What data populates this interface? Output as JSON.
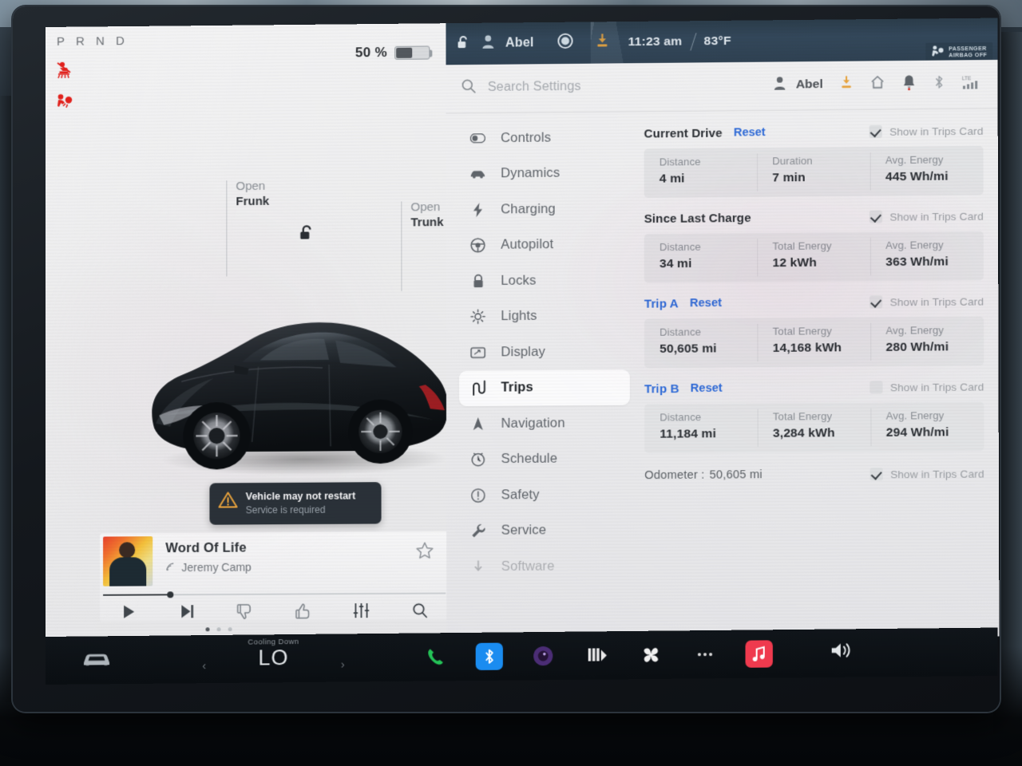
{
  "drive_panel": {
    "gear_indicator": "P R N D",
    "battery_percent": "50 %",
    "battery_level": 50,
    "warning_icons": [
      "seatbelt-warning-icon",
      "airbag-warning-icon"
    ],
    "frunk": {
      "action": "Open",
      "target": "Frunk"
    },
    "trunk": {
      "action": "Open",
      "target": "Trunk"
    },
    "lock_icon": "unlocked-padlock-icon",
    "charge_icon": "charge-bolt-icon",
    "toast": {
      "title": "Vehicle may not restart",
      "subtitle": "Service is required",
      "icon": "warning-triangle-icon"
    },
    "media": {
      "title": "Word Of Life",
      "artist": "Jeremy Camp",
      "source_icon": "streaming-icon",
      "favorite_icon": "star-outline-icon",
      "controls": [
        "play-icon",
        "next-track-icon",
        "thumbs-down-icon",
        "thumbs-up-icon",
        "equalizer-icon",
        "search-icon"
      ],
      "progress_percent": 19,
      "page_dots": 3,
      "active_dot": 1
    }
  },
  "status_bar": {
    "lock_icon": "unlocked-padlock-icon",
    "profile_icon": "person-icon",
    "driver_name": "Abel",
    "record_icon": "dashcam-record-icon",
    "download_icon": "software-download-icon",
    "time": "11:23 am",
    "temperature": "83°F",
    "airbag_notice_line1": "PASSENGER",
    "airbag_notice_line2": "AIRBAG OFF"
  },
  "search": {
    "placeholder": "Search Settings",
    "icon": "search-icon"
  },
  "header_icons": {
    "profile_name": "Abel",
    "items": [
      "person-icon",
      "software-download-icon",
      "home-icon",
      "notification-bell-icon",
      "bluetooth-icon",
      "lte-signal-icon"
    ],
    "lte_label": "LTE"
  },
  "sidebar": {
    "items": [
      {
        "label": "Controls",
        "icon": "toggle-switch-icon",
        "active": false,
        "dim": false
      },
      {
        "label": "Dynamics",
        "icon": "car-side-icon",
        "active": false,
        "dim": false
      },
      {
        "label": "Charging",
        "icon": "lightning-bolt-icon",
        "active": false,
        "dim": false
      },
      {
        "label": "Autopilot",
        "icon": "steering-wheel-icon",
        "active": false,
        "dim": false
      },
      {
        "label": "Locks",
        "icon": "padlock-icon",
        "active": false,
        "dim": false
      },
      {
        "label": "Lights",
        "icon": "headlight-icon",
        "active": false,
        "dim": false
      },
      {
        "label": "Display",
        "icon": "display-icon",
        "active": false,
        "dim": false
      },
      {
        "label": "Trips",
        "icon": "winding-road-icon",
        "active": true,
        "dim": false
      },
      {
        "label": "Navigation",
        "icon": "navigation-arrow-icon",
        "active": false,
        "dim": false
      },
      {
        "label": "Schedule",
        "icon": "clock-icon",
        "active": false,
        "dim": false
      },
      {
        "label": "Safety",
        "icon": "exclamation-circle-icon",
        "active": false,
        "dim": false
      },
      {
        "label": "Service",
        "icon": "wrench-icon",
        "active": false,
        "dim": false
      },
      {
        "label": "Software",
        "icon": "download-arrow-icon",
        "active": false,
        "dim": true
      }
    ]
  },
  "trips": {
    "show_label": "Show in Trips Card",
    "reset_label": "Reset",
    "sections": [
      {
        "title": "Current Drive",
        "title_is_link": false,
        "has_reset": true,
        "show_in_card": true,
        "cells": [
          {
            "key": "Distance",
            "value": "4 mi"
          },
          {
            "key": "Duration",
            "value": "7 min"
          },
          {
            "key": "Avg. Energy",
            "value": "445 Wh/mi"
          }
        ]
      },
      {
        "title": "Since Last Charge",
        "title_is_link": false,
        "has_reset": false,
        "show_in_card": true,
        "cells": [
          {
            "key": "Distance",
            "value": "34 mi"
          },
          {
            "key": "Total Energy",
            "value": "12 kWh"
          },
          {
            "key": "Avg. Energy",
            "value": "363 Wh/mi"
          }
        ]
      },
      {
        "title": "Trip A",
        "title_is_link": true,
        "has_reset": true,
        "show_in_card": true,
        "cells": [
          {
            "key": "Distance",
            "value": "50,605 mi"
          },
          {
            "key": "Total Energy",
            "value": "14,168 kWh"
          },
          {
            "key": "Avg. Energy",
            "value": "280 Wh/mi"
          }
        ]
      },
      {
        "title": "Trip B",
        "title_is_link": true,
        "has_reset": true,
        "show_in_card": false,
        "cells": [
          {
            "key": "Distance",
            "value": "11,184 mi"
          },
          {
            "key": "Total Energy",
            "value": "3,284 kWh"
          },
          {
            "key": "Avg. Energy",
            "value": "294 Wh/mi"
          }
        ]
      }
    ],
    "odometer_label": "Odometer :",
    "odometer_value": "50,605 mi",
    "odometer_show_in_card": true
  },
  "taskbar": {
    "car_icon": "car-front-icon",
    "climate_status": "Cooling Down",
    "climate_temp": "LO",
    "chevron_left": "‹",
    "chevron_right": "›",
    "apps": [
      {
        "name": "phone-icon",
        "color": "#24c257"
      },
      {
        "name": "bluetooth-icon",
        "color": "#1a8cf0"
      },
      {
        "name": "dashcam-icon",
        "color": "#6a3fa0"
      },
      {
        "name": "media-icon",
        "color": "#e8e8e8"
      },
      {
        "name": "fan-icon",
        "color": "#f0f0f0"
      },
      {
        "name": "more-dots-icon",
        "color": "#d8d8d8"
      },
      {
        "name": "music-app-icon",
        "color": "#ef3a4e"
      }
    ],
    "volume_icon": "speaker-volume-icon"
  },
  "colors": {
    "accent_link": "#2f6bd8",
    "warning_amber": "#e8a33d",
    "warning_red": "#e2211c",
    "screen_bg": "#e9e9ea",
    "card_bg": "#e2e3e5"
  }
}
